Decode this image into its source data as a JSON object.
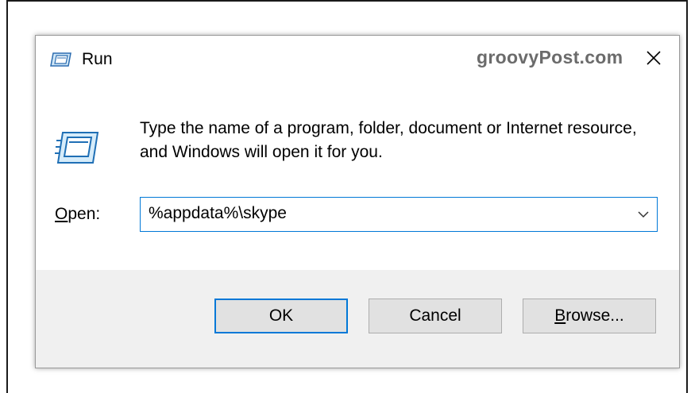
{
  "dialog": {
    "title": "Run",
    "brand": "groovyPost.com",
    "close_glyph": "✕",
    "description": "Type the name of a program, folder, document or Internet resource, and Windows will open it for you.",
    "open_label_accel": "O",
    "open_label_rest": "pen:",
    "input_value": "%appdata%\\skype",
    "buttons": {
      "ok": "OK",
      "cancel": "Cancel",
      "browse_accel": "B",
      "browse_rest": "rowse..."
    }
  },
  "colors": {
    "accent": "#0078d7",
    "footer_bg": "#f0f0f0",
    "button_bg": "#e1e1e1",
    "brand_text": "#6b6b6b"
  },
  "icons": [
    "run-icon",
    "close-icon",
    "chevron-down-icon"
  ]
}
